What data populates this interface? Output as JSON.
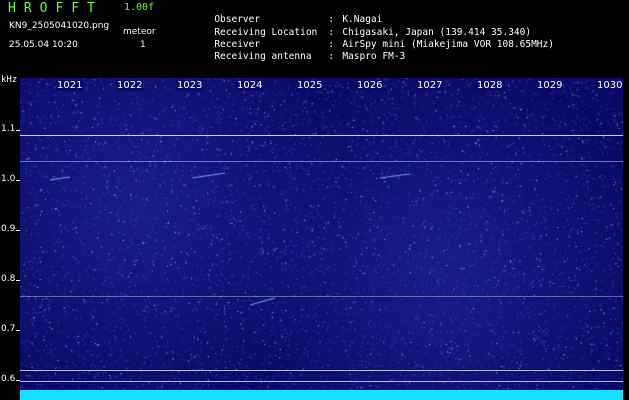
{
  "header": {
    "app_title": "HROFFT",
    "version": "1.00f",
    "file_name": "KN9_2505041020.png",
    "datetime": "25.05.04 10:20",
    "mode_label": "meteor",
    "mode_value": "1",
    "info": [
      {
        "key": "Observer",
        "value": "K.Nagai"
      },
      {
        "key": "Receiving Location",
        "value": "Chigasaki, Japan (139.414 35.340)"
      },
      {
        "key": "Receiver",
        "value": "AirSpy mini (Miakejima VOR 108.65MHz)"
      },
      {
        "key": "Receiving antenna",
        "value": "Maspro FM-3"
      }
    ]
  },
  "axes": {
    "y_unit": "kHz",
    "y_ticks": [
      "1.1",
      "1.0",
      "0.9",
      "0.8",
      "0.7",
      "0.6"
    ],
    "x_ticks": [
      "1021",
      "1022",
      "1023",
      "1024",
      "1025",
      "1026",
      "1027",
      "1028",
      "1029",
      "1030"
    ]
  },
  "colors": {
    "background": "#0a0a66",
    "signal": "#15e0ff",
    "text_green": "#66ff33",
    "text_white": "#ffffff"
  }
}
